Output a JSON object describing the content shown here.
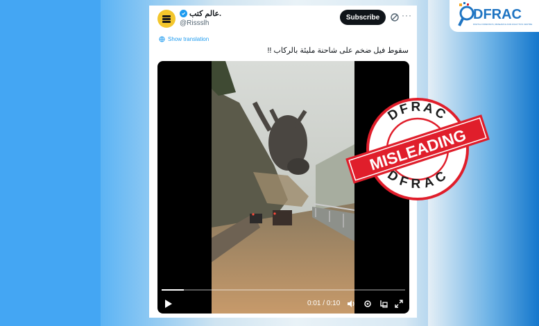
{
  "tweet": {
    "display_name": "عالم كتب.",
    "handle": "@Rissslh",
    "subscribe_label": "Subscribe",
    "more_label": "···",
    "translate_label": "Show translation",
    "text": "سقوط فيل ضخم على شاحنة مليئة بالركاب !!"
  },
  "video": {
    "time": "0:01 / 0:10",
    "progress": 0.09,
    "controls": [
      "play-icon",
      "volume-icon",
      "settings-icon",
      "picture-in-picture-icon",
      "fullscreen-icon"
    ]
  },
  "stamp": {
    "top_text": "DFRAC",
    "bottom_text": "DFRAC",
    "label": "MISLEADING",
    "color": "#e01e2b"
  },
  "logo": {
    "text": "DFRAC",
    "sub": "DIGITAL FORENSICS, RESEARCH AND ANALYTICS CENTRE"
  },
  "colors": {
    "accent": "#1d9bf0",
    "stamp_red": "#e01e2b",
    "brand_blue": "#1e74c2"
  }
}
